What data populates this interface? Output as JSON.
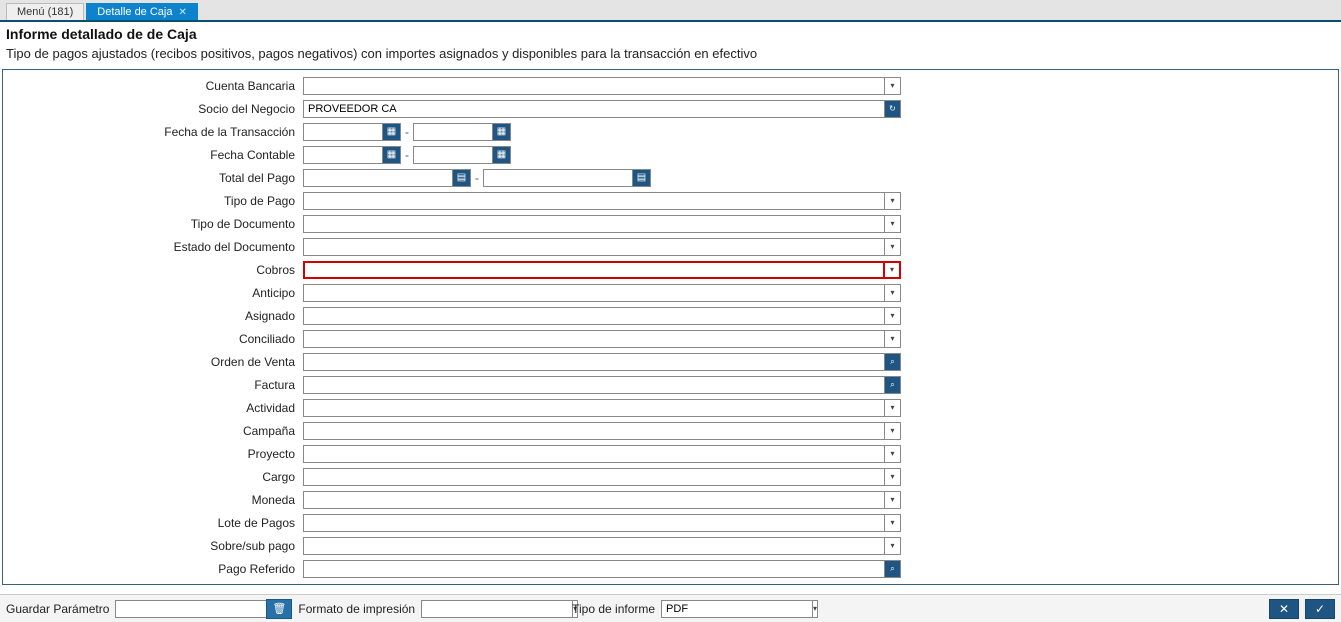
{
  "tabs": {
    "menu": "Menú (181)",
    "active": "Detalle de Caja"
  },
  "title": "Informe detallado de de Caja",
  "subtitle": "Tipo de pagos ajustados (recibos positivos, pagos negativos) con importes asignados y disponibles para la transacción en efectivo",
  "labels": {
    "cuenta_bancaria": "Cuenta Bancaria",
    "socio_negocio": "Socio del Negocio",
    "fecha_transaccion": "Fecha de la Transacción",
    "fecha_contable": "Fecha Contable",
    "total_pago": "Total del Pago",
    "tipo_pago": "Tipo de Pago",
    "tipo_documento": "Tipo de Documento",
    "estado_documento": "Estado del Documento",
    "cobros": "Cobros",
    "anticipo": "Anticipo",
    "asignado": "Asignado",
    "conciliado": "Conciliado",
    "orden_venta": "Orden de Venta",
    "factura": "Factura",
    "actividad": "Actividad",
    "campana": "Campaña",
    "proyecto": "Proyecto",
    "cargo": "Cargo",
    "moneda": "Moneda",
    "lote_pagos": "Lote de Pagos",
    "sobre_sub_pago": "Sobre/sub pago",
    "pago_referido": "Pago Referido"
  },
  "values": {
    "cuenta_bancaria": "",
    "socio_negocio": "PROVEEDOR CA",
    "fecha_trans_from": "",
    "fecha_trans_to": "",
    "fecha_cont_from": "",
    "fecha_cont_to": "",
    "total_pago_from": "",
    "total_pago_to": "",
    "tipo_pago": "",
    "tipo_documento": "",
    "estado_documento": "",
    "cobros": "",
    "anticipo": "",
    "asignado": "",
    "conciliado": "",
    "orden_venta": "",
    "factura": "",
    "actividad": "",
    "campana": "",
    "proyecto": "",
    "cargo": "",
    "moneda": "",
    "lote_pagos": "",
    "sobre_sub_pago": "",
    "pago_referido": ""
  },
  "footer": {
    "guardar_parametro": "Guardar Parámetro",
    "guardar_parametro_value": "",
    "formato_impresion": "Formato de impresión",
    "formato_impresion_value": "",
    "tipo_informe": "Tipo de informe",
    "tipo_informe_value": "PDF"
  },
  "icons": {
    "dropdown": "▾",
    "lookup": "⌕",
    "refresh": "↻",
    "calendar": "▦",
    "calc": "▤",
    "trash": "🗑",
    "cancel": "✕",
    "ok": "✓"
  }
}
